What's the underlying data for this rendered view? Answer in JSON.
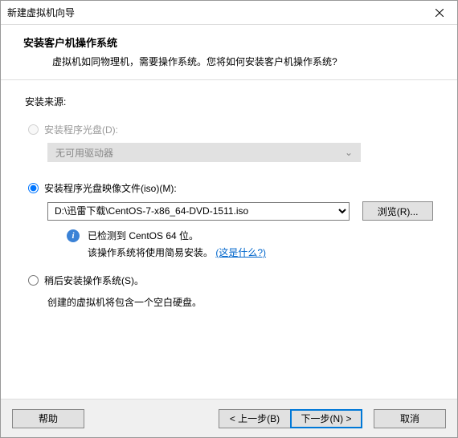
{
  "window": {
    "title": "新建虚拟机向导"
  },
  "header": {
    "title": "安装客户机操作系统",
    "description": "虚拟机如同物理机，需要操作系统。您将如何安装客户机操作系统?"
  },
  "source": {
    "label": "安装来源:",
    "option_disc": {
      "label": "安装程序光盘(D):",
      "dropdown": "无可用驱动器"
    },
    "option_iso": {
      "label": "安装程序光盘映像文件(iso)(M):",
      "value": "D:\\迅雷下载\\CentOS-7-x86_64-DVD-1511.iso",
      "browse": "浏览(R)..."
    },
    "info": {
      "line1": "已检测到 CentOS 64 位。",
      "line2_prefix": "该操作系统将使用简易安装。",
      "link": "(这是什么?)"
    },
    "option_later": {
      "label": "稍后安装操作系统(S)。",
      "note": "创建的虚拟机将包含一个空白硬盘。"
    }
  },
  "footer": {
    "help": "帮助",
    "back": "< 上一步(B)",
    "next": "下一步(N) >",
    "cancel": "取消"
  }
}
